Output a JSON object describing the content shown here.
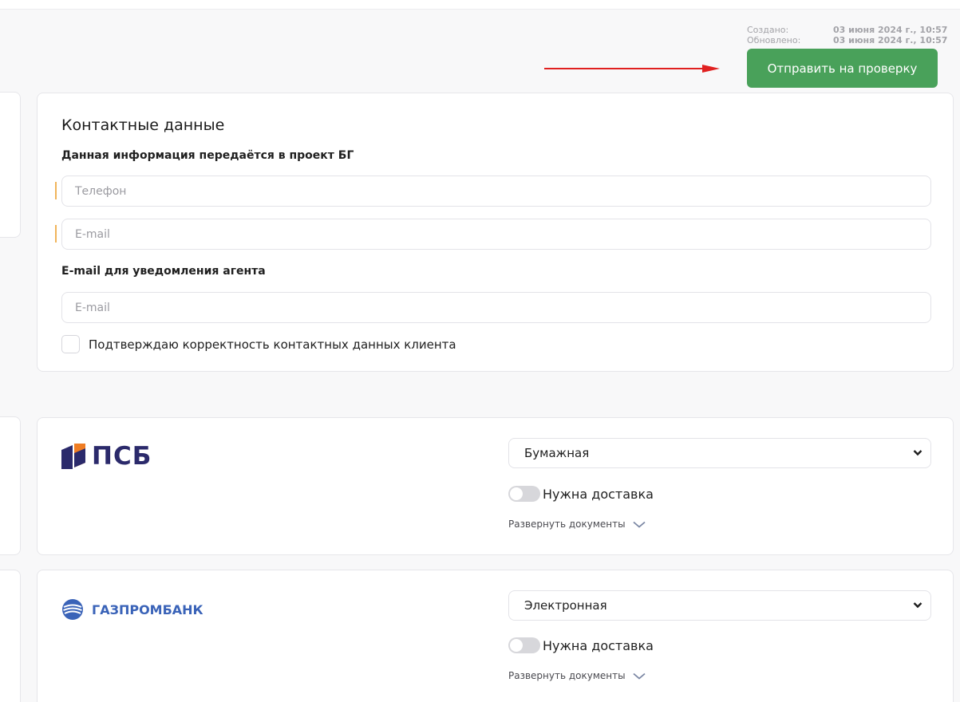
{
  "header": {
    "created_label": "Создано:",
    "created_value": "03 июня 2024 г., 10:57",
    "updated_label": "Обновлено:",
    "updated_value": "03 июня 2024 г., 10:57",
    "submit_label": "Отправить на проверку"
  },
  "annotation": {
    "arrow_color": "#e02020"
  },
  "contacts": {
    "title": "Контактные данные",
    "subtitle": "Данная информация передаётся в проект БГ",
    "phone_placeholder": "Телефон",
    "email_placeholder": "E-mail",
    "agent_label": "E-mail для уведомления агента",
    "agent_email_placeholder": "E-mail",
    "confirm_label": "Подтверждаю корректность контактных данных клиента"
  },
  "banks": [
    {
      "logo_text": "ПСБ",
      "icon": "psb-logo-icon",
      "format": "Бумажная",
      "delivery_label": "Нужна доставка",
      "expand_label": "Развернуть документы"
    },
    {
      "logo_text": "ГАЗПРОМБАНК",
      "icon": "gazprombank-logo-icon",
      "format": "Электронная",
      "delivery_label": "Нужна доставка",
      "expand_label": "Развернуть документы"
    }
  ],
  "colors": {
    "accent_green": "#49a15a",
    "required_mark": "#f0b45a",
    "psb_blue": "#2b2a6b",
    "psb_orange": "#ef7d23",
    "gpb_blue": "#3a63b8"
  }
}
